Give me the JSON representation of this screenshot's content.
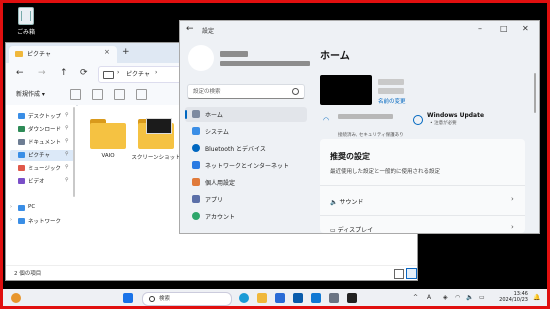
{
  "desktop": {
    "recycle_label": "ごみ箱"
  },
  "explorer": {
    "tab_title": "ピクチャ",
    "tab_close": "×",
    "new_tab": "+",
    "nav": {
      "back": "←",
      "forward": "→",
      "up": "↑",
      "refresh": "⟳"
    },
    "path": [
      "›",
      "ピクチャ",
      "›"
    ],
    "new_button": "新規作成 ▾",
    "sidebar": [
      {
        "label": "デスクトップ",
        "pinned": true,
        "color": "#3a8ee6"
      },
      {
        "label": "ダウンロード",
        "pinned": true,
        "color": "#2e8b57"
      },
      {
        "label": "ドキュメント",
        "pinned": true,
        "color": "#6d7d93"
      },
      {
        "label": "ピクチャ",
        "pinned": true,
        "color": "#3a8ee6",
        "selected": true
      },
      {
        "label": "ミュージック",
        "pinned": true,
        "color": "#e0584a"
      },
      {
        "label": "ビデオ",
        "pinned": true,
        "color": "#7a4fc8"
      },
      {
        "label": "PC",
        "color": "#3a8ee6"
      },
      {
        "label": "ネットワーク",
        "color": "#3a8ee6"
      }
    ],
    "folders": [
      {
        "name": "VAIO"
      },
      {
        "name": "スクリーンショット"
      }
    ],
    "status": "2 個の項目"
  },
  "settings": {
    "title": "設定",
    "window_controls": {
      "minimize": "–",
      "maximize": "□",
      "close": "✕"
    },
    "search_placeholder": "設定の検索",
    "nav": [
      {
        "label": "ホーム",
        "color": "#7d8aa0",
        "selected": true
      },
      {
        "label": "システム",
        "color": "#3a8ee6"
      },
      {
        "label": "Bluetooth とデバイス",
        "color": "#0067c0"
      },
      {
        "label": "ネットワークとインターネット",
        "color": "#2a7ae2"
      },
      {
        "label": "個人用設定",
        "color": "#e07a3a"
      },
      {
        "label": "アプリ",
        "color": "#5b6fa8"
      },
      {
        "label": "アカウント",
        "color": "#2ea66b"
      }
    ],
    "main_title": "ホーム",
    "rename": "名前の変更",
    "wifi_status": "接続済み, セキュリティ保護あり",
    "windows_update": {
      "title": "Windows Update",
      "status": "注意が必要"
    },
    "card": {
      "title": "推奨の設定",
      "subtitle": "最近使用した設定と一般的に使用される設定",
      "rows": [
        {
          "label": "サウンド",
          "chevron": "›"
        },
        {
          "label": "ディスプレイ",
          "chevron": "›"
        }
      ]
    }
  },
  "taskbar": {
    "search_label": "検索",
    "tray_chevron": "^",
    "ime": "A",
    "time": "13:46",
    "date": "2024/10/23",
    "apps": [
      {
        "icon": "windows-icon",
        "color": "#1a73e8"
      },
      {
        "icon": "edge-icon",
        "color": "#1c9bd6"
      },
      {
        "icon": "explorer-icon",
        "color": "#f0b83c"
      },
      {
        "icon": "store-icon",
        "color": "#2b6cd6"
      },
      {
        "icon": "outlook-icon",
        "color": "#0b5cab"
      },
      {
        "icon": "mail-icon",
        "color": "#1279d3"
      },
      {
        "icon": "settings-icon",
        "color": "#6b7483"
      },
      {
        "icon": "terminal-icon",
        "color": "#222222"
      }
    ]
  }
}
